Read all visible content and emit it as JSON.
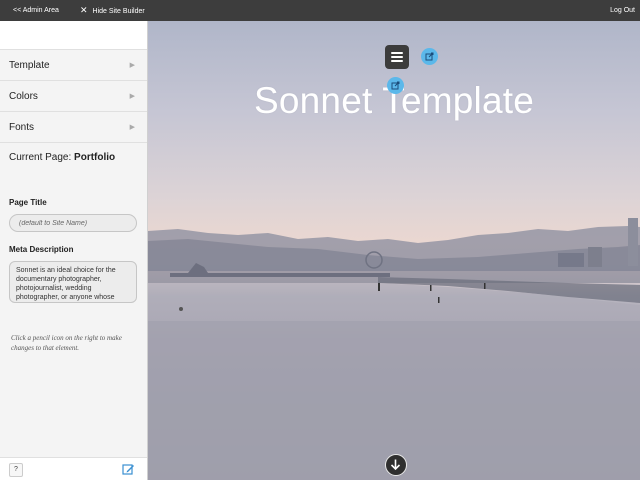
{
  "topbar": {
    "admin_area": "<< Admin Area",
    "hide_builder": "Hide Site Builder",
    "logout": "Log Out"
  },
  "sidebar": {
    "menu": [
      {
        "label": "Template"
      },
      {
        "label": "Colors"
      },
      {
        "label": "Fonts"
      }
    ],
    "current_page_prefix": "Current Page:",
    "current_page_name": "Portfolio",
    "page_title_label": "Page Title",
    "page_title_placeholder": "(default to Site Name)",
    "meta_label": "Meta Description",
    "meta_value": "Sonnet is an ideal choice for the documentary photographer, photojournalist, wedding photographer, or anyone whose work",
    "hint": "Click a pencil icon on the right to make changes to that element.",
    "help_label": "?"
  },
  "hero": {
    "title": "Sonnet Template"
  },
  "icons": {
    "menu": "hamburger-icon",
    "edit": "external-edit-icon",
    "scroll": "arrow-down-circle-icon",
    "pencil": "pencil-edit-icon"
  },
  "colors": {
    "topbar_bg": "#3d3d3d",
    "sidebar_bg": "#f4f4f4",
    "edit_dot": "#5bb8ea",
    "menu_btn": "#3c3c3c"
  }
}
